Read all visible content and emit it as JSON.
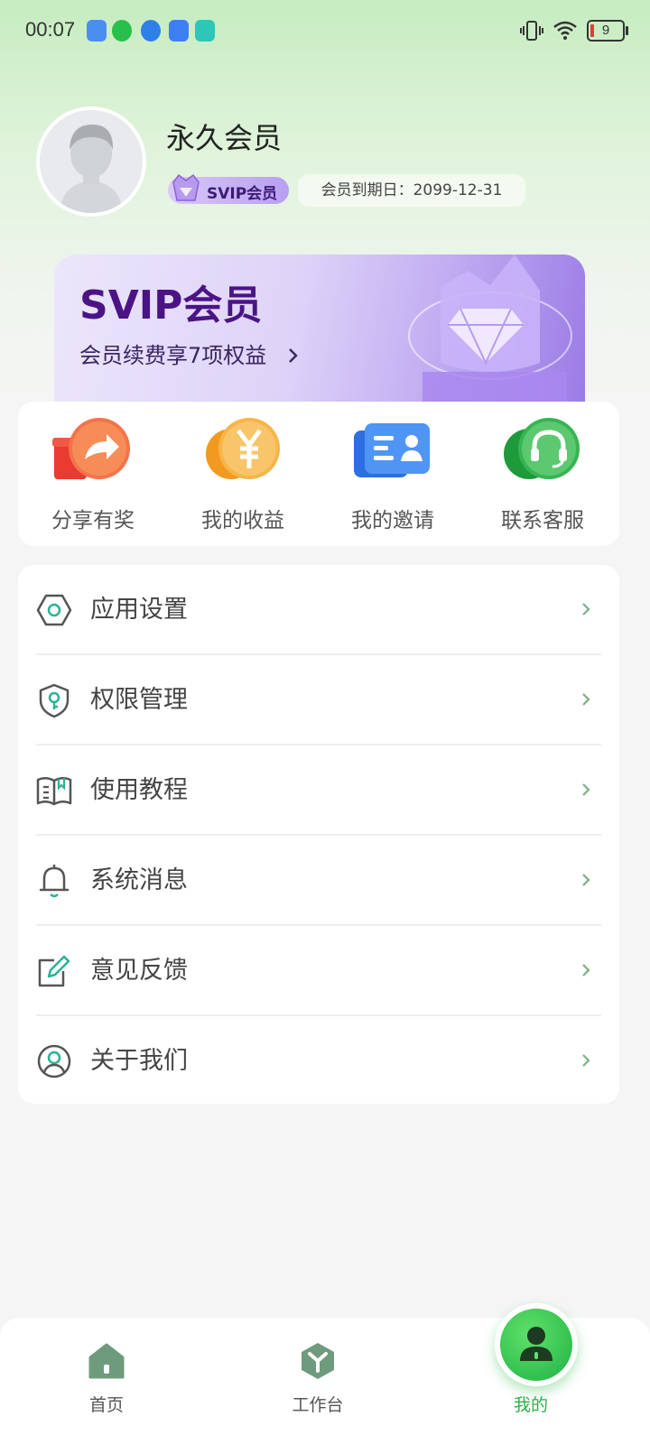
{
  "status_bar": {
    "time": "00:07",
    "battery": "9"
  },
  "profile": {
    "username": "永久会员",
    "badge": "SVIP会员",
    "expiry": "会员到期日：2099-12-31"
  },
  "banner": {
    "title": "SVIP会员",
    "subtitle": "会员续费享7项权益"
  },
  "quick_actions": [
    {
      "label": "分享有奖",
      "icon": "gift-share-icon"
    },
    {
      "label": "我的收益",
      "icon": "yen-coin-icon"
    },
    {
      "label": "我的邀请",
      "icon": "contact-card-icon"
    },
    {
      "label": "联系客服",
      "icon": "headset-icon"
    }
  ],
  "menu": [
    {
      "label": "应用设置",
      "icon": "settings-hex-icon"
    },
    {
      "label": "权限管理",
      "icon": "shield-key-icon"
    },
    {
      "label": "使用教程",
      "icon": "book-icon"
    },
    {
      "label": "系统消息",
      "icon": "bell-icon"
    },
    {
      "label": "意见反馈",
      "icon": "edit-icon"
    },
    {
      "label": "关于我们",
      "icon": "user-circle-icon"
    }
  ],
  "bottom_nav": [
    {
      "label": "首页",
      "icon": "home-icon"
    },
    {
      "label": "工作台",
      "icon": "workbench-icon"
    },
    {
      "label": "我的",
      "icon": "profile-icon",
      "active": true
    }
  ],
  "colors": {
    "accent": "#2bb24c",
    "svip_purple": "#4a1485",
    "chevron": "#7bb086"
  }
}
